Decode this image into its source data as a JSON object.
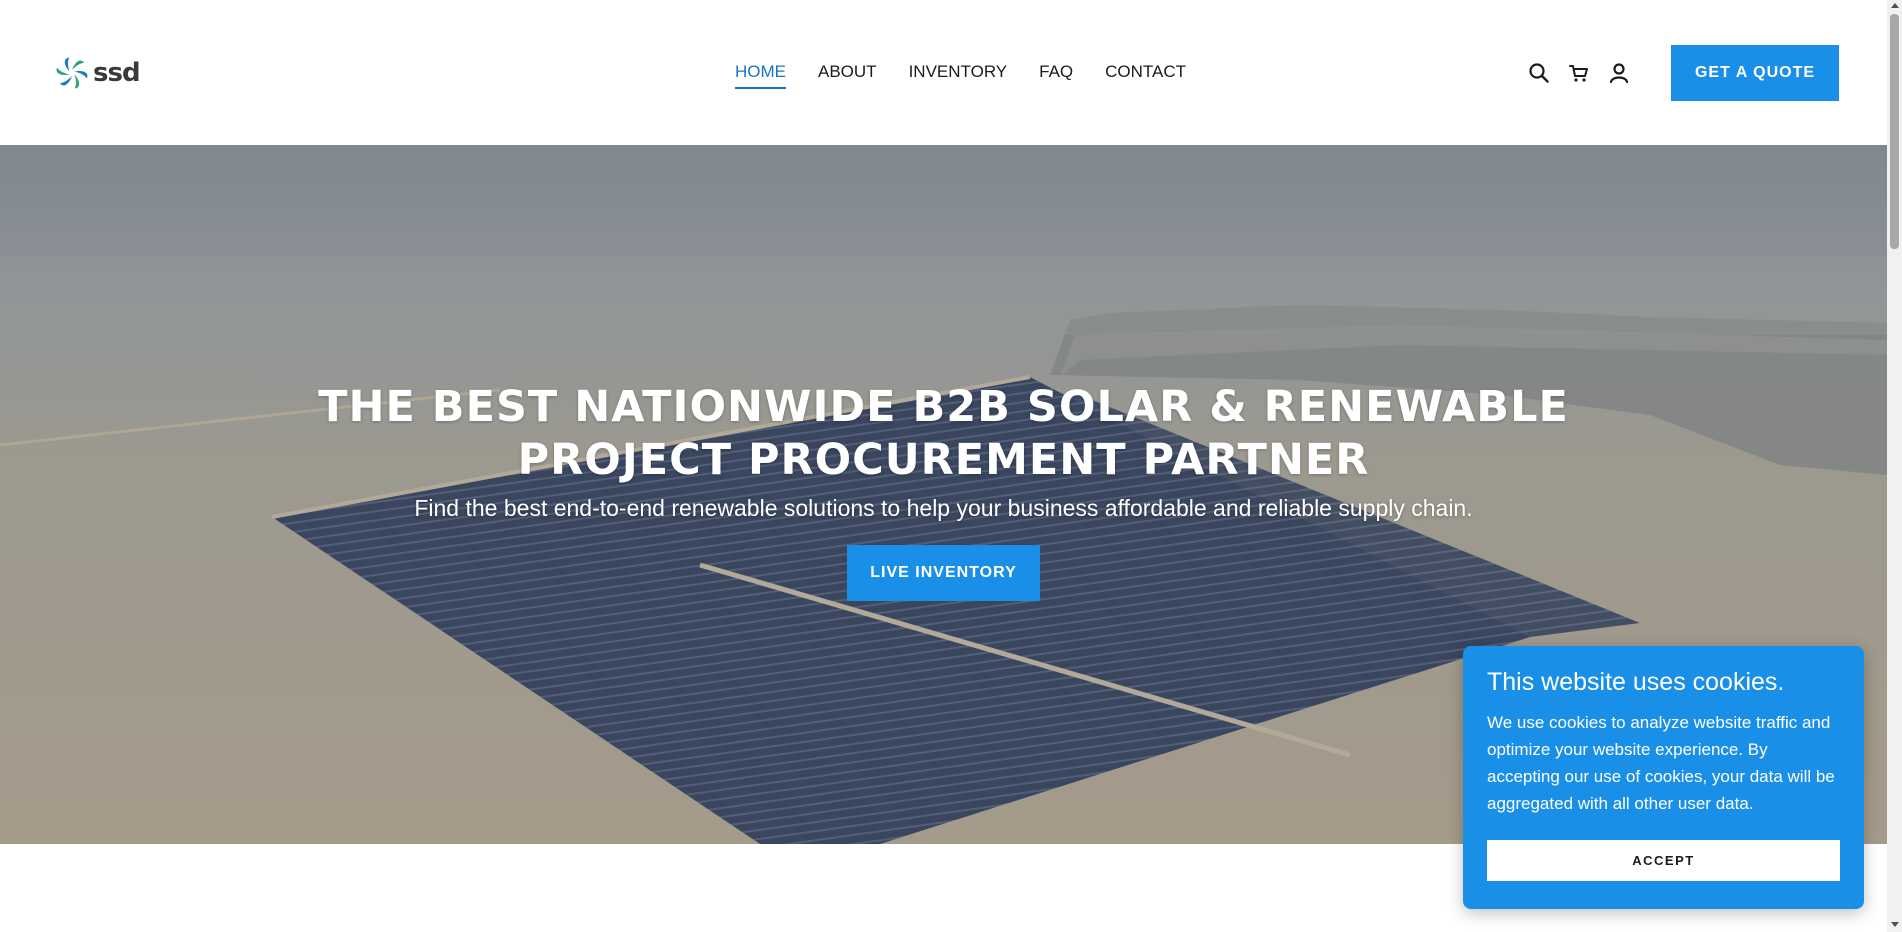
{
  "brand": {
    "name": "ssd",
    "accent": "#1a8fe8",
    "nav_active": "#1a74c4"
  },
  "nav": {
    "items": [
      {
        "label": "HOME",
        "active": true
      },
      {
        "label": "ABOUT",
        "active": false
      },
      {
        "label": "INVENTORY",
        "active": false
      },
      {
        "label": "FAQ",
        "active": false
      },
      {
        "label": "CONTACT",
        "active": false
      }
    ]
  },
  "header": {
    "icons": [
      "search-icon",
      "cart-icon",
      "account-icon"
    ],
    "quote_button": "GET A QUOTE"
  },
  "hero": {
    "title_line1": "THE BEST NATIONWIDE B2B SOLAR & RENEWABLE",
    "title_line2": "PROJECT PROCUREMENT PARTNER",
    "subtitle": "Find the best end-to-end renewable solutions to help your business affordable and reliable supply chain.",
    "button": "LIVE INVENTORY"
  },
  "cookie": {
    "title": "This website uses cookies.",
    "body": "We use cookies to analyze website traffic and optimize your website experience. By accepting our use of cookies, your data will be aggregated with all other user data.",
    "accept": "ACCEPT"
  }
}
